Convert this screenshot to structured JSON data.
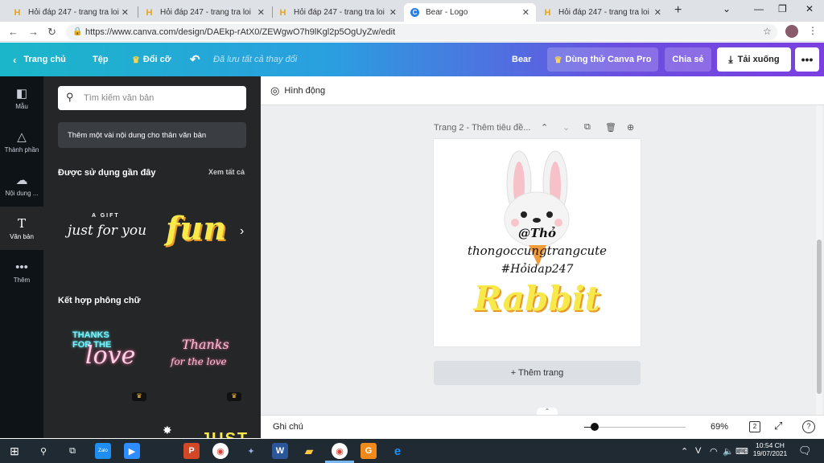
{
  "browser": {
    "tabs": [
      {
        "title": "Hỏi đáp 247 - trang tra loi",
        "favicon": "H"
      },
      {
        "title": "Hỏi đáp 247 - trang tra loi",
        "favicon": "H"
      },
      {
        "title": "Hỏi đáp 247 - trang tra loi",
        "favicon": "H"
      },
      {
        "title": "Bear - Logo",
        "favicon": "C"
      },
      {
        "title": "Hỏi đáp 247 - trang tra loi",
        "favicon": "H"
      }
    ],
    "url": "https://www.canva.com/design/DAEkp-rAtX0/ZEWgwO7h9lKgl2p5OgUyZw/edit"
  },
  "topbar": {
    "home": "Trang chủ",
    "file": "Tệp",
    "resize": "Đổi cỡ",
    "saved": "Đã lưu tất cả thay đổi",
    "design_name": "Bear",
    "try_pro": "Dùng thử Canva Pro",
    "share": "Chia sẻ",
    "download": "Tải xuống"
  },
  "rail": {
    "items": [
      {
        "label": "Mẫu",
        "icon": "template-icon"
      },
      {
        "label": "Thành phần",
        "icon": "elements-icon"
      },
      {
        "label": "Nội dung ...",
        "icon": "upload-icon"
      },
      {
        "label": "Văn bản",
        "icon": "text-icon"
      },
      {
        "label": "Thêm",
        "icon": "more-icon"
      }
    ]
  },
  "panel": {
    "search_placeholder": "Tìm kiếm văn bản",
    "add_body": "Thêm một vài nội dung cho thân văn bản",
    "recent_title": "Được sử dụng gần đây",
    "see_all": "Xem tất cả",
    "recent": {
      "gift_small": "A GIFT",
      "gift_script": "just for you",
      "fun": "fun"
    },
    "combo_title": "Kết hợp phông chữ",
    "combo": {
      "thanks1": "THANKS",
      "thanks2": "FOR THE",
      "love": "love",
      "script1": "Thanks",
      "script2": "for the love"
    },
    "bottom_peek": "JUST"
  },
  "editor": {
    "animate": "Hình động",
    "page_label": "Trang 2 - Thêm tiêu đề...",
    "add_page": "+ Thêm trang",
    "notes": "Ghi chú",
    "zoom": "69%",
    "zoom_fraction": 0.1,
    "page_count": "2"
  },
  "design": {
    "line1": "@Thỏ",
    "line2": "thongoccungtrangcute",
    "line3": "#Hỏidap247",
    "title": "Rabbit"
  },
  "taskbar": {
    "time": "10:54 CH",
    "date": "19/07/2021",
    "tray_letter": "V"
  },
  "colors": {
    "accent_yellow": "#f7e94a",
    "neon_pink": "#ff6fa8",
    "neon_cyan": "#6ff6ff"
  }
}
